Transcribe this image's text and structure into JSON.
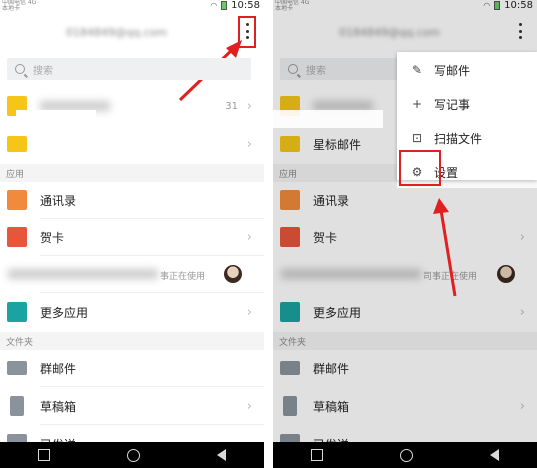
{
  "status": {
    "carrier_line1": "中国电信 4G",
    "carrier_line2": "本地卡",
    "time": "10:58"
  },
  "header": {
    "account_email": "0184849@qq.com"
  },
  "search": {
    "placeholder": "搜索"
  },
  "inbox": {
    "row1_count": "31",
    "row2_label": "星标邮件"
  },
  "sections": {
    "apps": "应用",
    "folders": "文件夹"
  },
  "apps": [
    {
      "label": "通讯录",
      "color": "#f08a3c"
    },
    {
      "label": "贺卡",
      "color": "#e8553a"
    },
    {
      "label": "事正在使用"
    },
    {
      "label": "更多应用",
      "color": "#1aa3a0"
    }
  ],
  "apps_right_third_label": "司事正在使用",
  "folders": [
    {
      "label": "群邮件"
    },
    {
      "label": "草稿箱"
    },
    {
      "label": "已发送"
    }
  ],
  "menu": {
    "items": [
      {
        "label": "写邮件",
        "icon": "edit-icon"
      },
      {
        "label": "写记事",
        "icon": "plus-icon"
      },
      {
        "label": "扫描文件",
        "icon": "scan-icon"
      },
      {
        "label": "设置",
        "icon": "gear-icon"
      }
    ]
  },
  "colors": {
    "accent_red": "#e02020",
    "inbox_yellow": "#f5c518"
  }
}
